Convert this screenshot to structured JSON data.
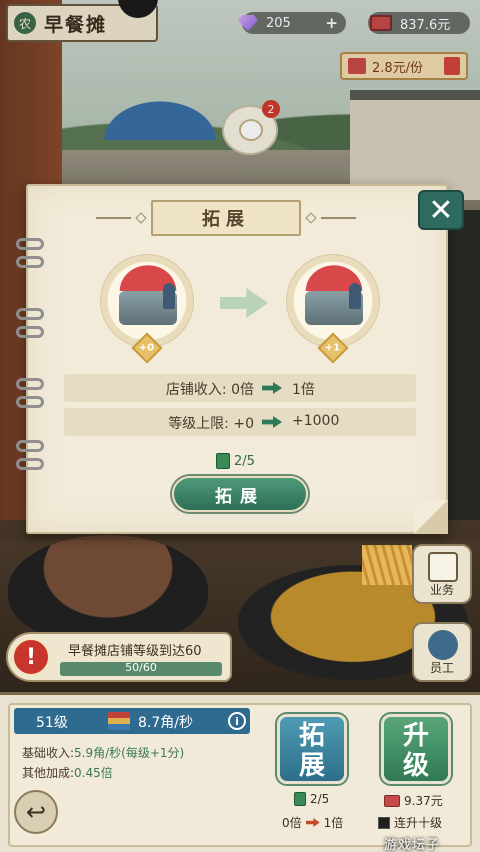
{
  "stall": {
    "name": "早餐摊",
    "seal": "农"
  },
  "hud": {
    "gems": "205",
    "money": "837.6元",
    "price": "2.8元/份",
    "bubble_count": "2"
  },
  "dialog": {
    "title": "拓展",
    "level_before": "+0",
    "level_after": "+1",
    "stats": [
      {
        "label": "店铺收入: 0倍",
        "new": "1倍"
      },
      {
        "label": "等级上限: +0",
        "new": "+1000"
      }
    ],
    "requirement": "2/5",
    "button": "拓展",
    "close": "✕"
  },
  "side": {
    "business_label": "业务",
    "staff_label": "员工"
  },
  "task": {
    "text": "早餐摊店铺等级到达60",
    "progress": "50/60",
    "progress_fraction": 0.83
  },
  "panel": {
    "level": "51级",
    "rate": "8.7角/秒",
    "info": "i",
    "base_label": "基础收入:",
    "base_value": "5.9角/秒(每级+1分)",
    "extra_label": "其他加成:",
    "extra_value": "0.45倍",
    "expand_btn_top": "拓",
    "expand_btn_bottom": "展",
    "upgrade_btn_top": "升",
    "upgrade_btn_bottom": "级",
    "expand_req": "2/5",
    "expand_from": "0倍",
    "expand_to": "1倍",
    "upgrade_cost": "9.37元",
    "multi_upgrade": "连升十级",
    "back": "↩"
  },
  "watermark": "游戏坛子",
  "colors": {
    "accent_green": "#2f7a52",
    "accent_teal": "#2f6a5e",
    "alert_red": "#c8352c"
  }
}
